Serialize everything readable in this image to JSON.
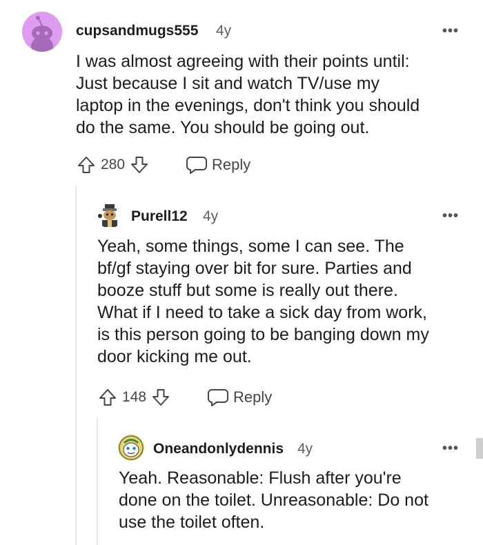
{
  "comments": [
    {
      "username": "cupsandmugs555",
      "age": "4y",
      "lines": [
        "I was almost agreeing with their points until:",
        "Just because I sit and watch TV/use my",
        "laptop in the evenings, don't think you should",
        "do the same. You should be going out."
      ],
      "votes": "280",
      "reply_label": "Reply",
      "more_label": "•••"
    },
    {
      "username": "Purell12",
      "age": "4y",
      "lines": [
        "Yeah, some things, some I can see. The",
        "bf/gf staying over bit for sure. Parties and",
        "booze stuff but some is really out there.",
        "What if I need to take a sick day from work,",
        "is this person going to be banging down my",
        "door kicking me out."
      ],
      "votes": "148",
      "reply_label": "Reply",
      "more_label": "•••"
    },
    {
      "username": "Oneandonlydennis",
      "age": "4y",
      "lines": [
        "Yeah. Reasonable: Flush after you're",
        "done on the toilet. Unreasonable: Do not",
        "use the toilet often."
      ],
      "more_label": "•••"
    }
  ],
  "colors": {
    "avatar1_bg": "#dd9cf0",
    "avatar3_bg": "#e8d96a",
    "thread_line": "#e6e6e6"
  }
}
